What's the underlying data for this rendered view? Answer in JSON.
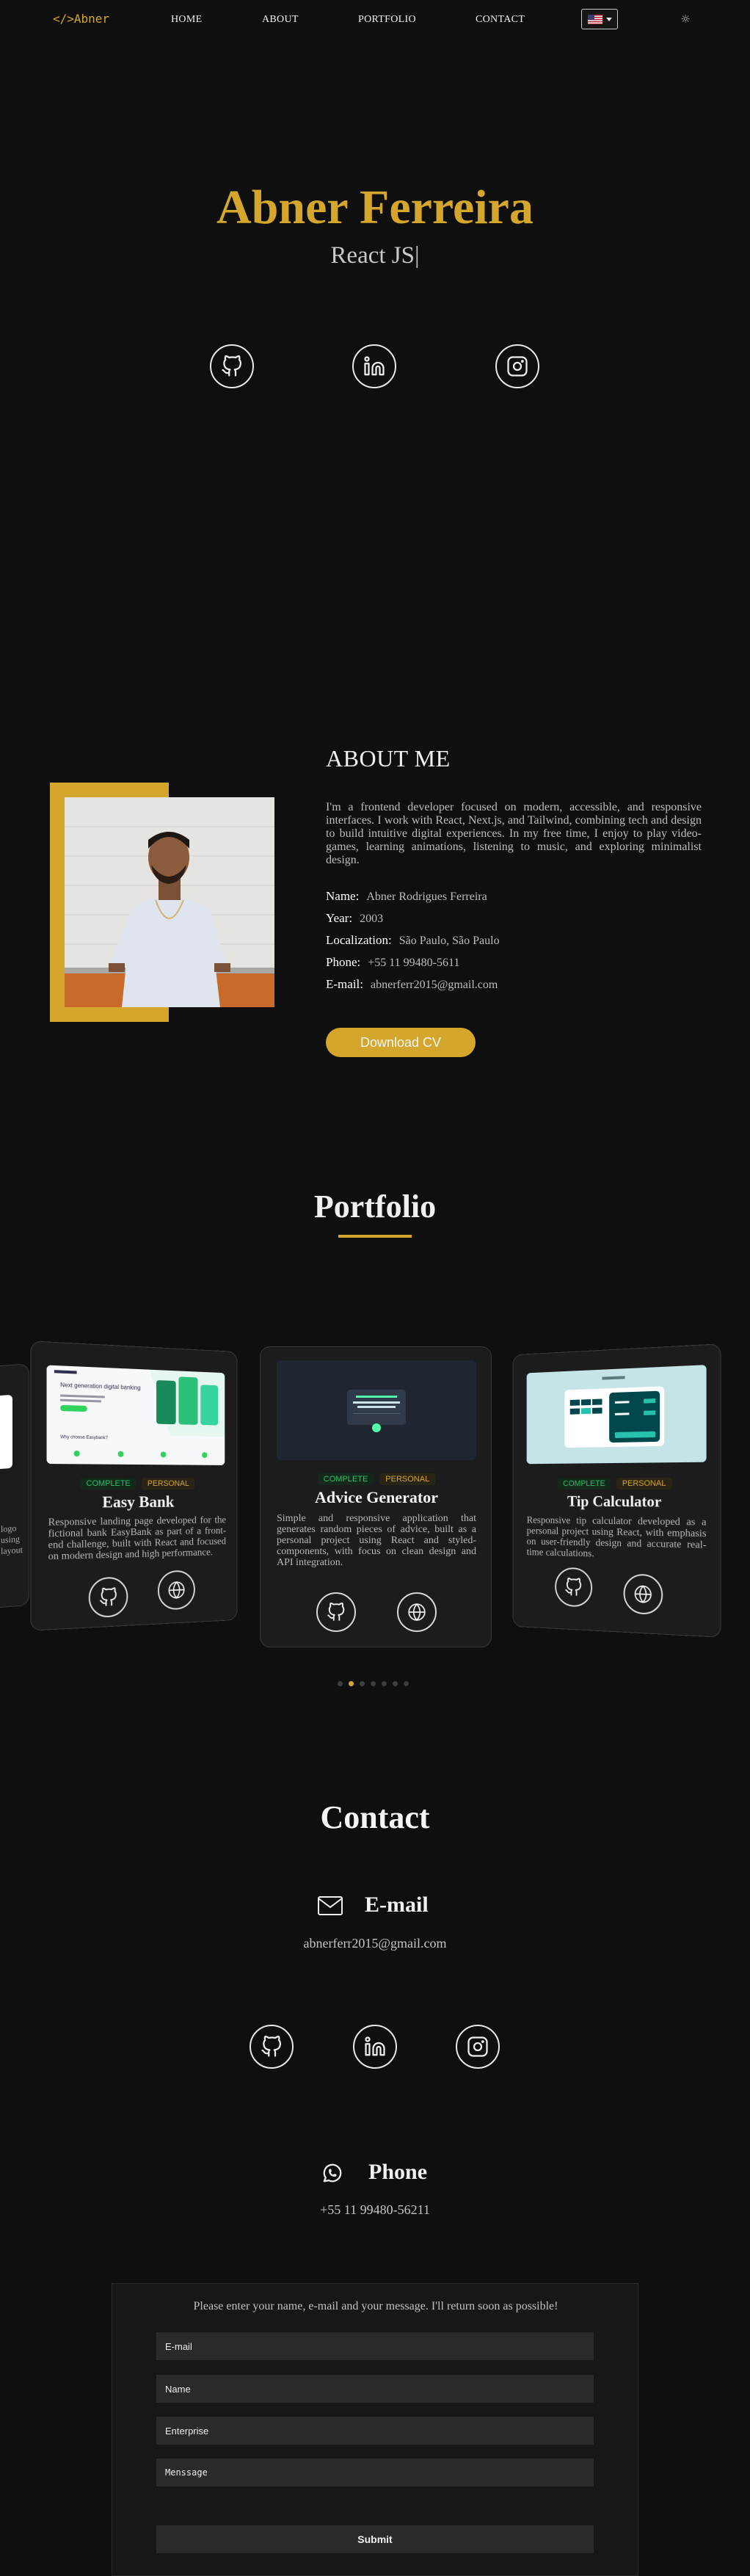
{
  "nav": {
    "logo": "</>Abner",
    "links": [
      "HOME",
      "ABOUT",
      "PORTFOLIO",
      "CONTACT"
    ],
    "language_icon": "us-flag-icon",
    "theme_icon": "sun-icon"
  },
  "hero": {
    "name": "Abner Ferreira",
    "role": "React JS|",
    "social_icons": [
      "github-icon",
      "linkedin-icon",
      "instagram-icon"
    ]
  },
  "about": {
    "heading": "ABOUT ME",
    "paragraph": "I'm a frontend developer focused on modern, accessible, and responsive interfaces. I work with React, Next.js, and Tailwind, combining tech and design to build intuitive digital experiences. In my free time, I enjoy to play video-games, learning animations, listening to music, and exploring minimalist design.",
    "info": [
      {
        "label": "Name:",
        "value": "Abner Rodrigues Ferreira"
      },
      {
        "label": "Year:",
        "value": "2003"
      },
      {
        "label": "Localization:",
        "value": "São Paulo, São Paulo"
      },
      {
        "label": "Phone:",
        "value": "+55 11 99480-5611"
      },
      {
        "label": "E-mail:",
        "value": "abnerferr2015@gmail.com"
      }
    ],
    "cv_button": "Download CV"
  },
  "portfolio": {
    "heading": "Portfolio",
    "left_card_fragment": [
      "logo",
      "using",
      "layout"
    ],
    "cards": [
      {
        "title": "Easy Bank",
        "tags": [
          "COMPLETE",
          "PERSONAL"
        ],
        "description": "Responsive landing page developed for the fictional bank EasyBank as part of a front-end challenge, built with React and focused on modern design and high performance.",
        "shot_heading": "Next generation digital banking",
        "shot_sub": "Why choose Easybank?"
      },
      {
        "title": "Advice Generator",
        "tags": [
          "COMPLETE",
          "PERSONAL"
        ],
        "description": "Simple and responsive application that generates random pieces of advice, built as a personal project using React and styled-components, with focus on clean design and API integration."
      },
      {
        "title": "Tip Calculator",
        "tags": [
          "COMPLETE",
          "PERSONAL"
        ],
        "description": "Responsive tip calculator developed as a personal project using React, with emphasis on user-friendly design and accurate real-time calculations."
      }
    ],
    "carousel_pages": 7,
    "carousel_active": 1
  },
  "contact": {
    "heading": "Contact",
    "email_heading": "E-mail",
    "email": "abnerferr2015@gmail.com",
    "phone_heading": "Phone",
    "phone": "+55 11 99480-56211",
    "form": {
      "note": "Please enter your name, e-mail and your message. I'll return soon as possible!",
      "email_placeholder": "E-mail",
      "name_placeholder": "Name",
      "enterprise_placeholder": "Enterprise",
      "message_placeholder": "Menssage",
      "submit": "Submit"
    }
  },
  "colors": {
    "accent": "#d4a72c",
    "background": "#0f0f0f",
    "card": "#1c1c1c",
    "complete_tag": "#29c36a"
  }
}
